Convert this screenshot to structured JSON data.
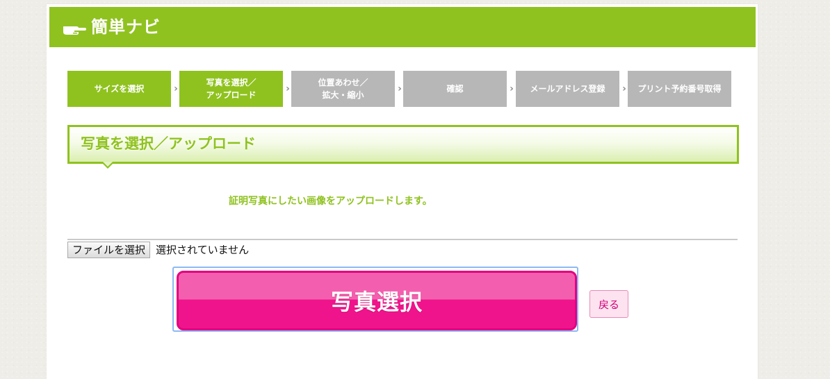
{
  "header": {
    "icon": "pointing-hand-icon",
    "title": "簡単ナビ"
  },
  "steps": [
    {
      "label": "サイズを選択",
      "state": "active"
    },
    {
      "label": "写真を選択／\nアップロード",
      "state": "active"
    },
    {
      "label": "位置あわせ／\n拡大・縮小",
      "state": "inactive"
    },
    {
      "label": "確認",
      "state": "inactive"
    },
    {
      "label": "メールアドレス登録",
      "state": "inactive"
    },
    {
      "label": "プリント予約番号取得",
      "state": "inactive"
    }
  ],
  "section": {
    "title": "写真を選択／アップロード"
  },
  "instruction": "証明写真にしたい画像をアップロードします。",
  "file_input": {
    "button_label": "ファイルを選択",
    "status": "選択されていません"
  },
  "actions": {
    "submit_label": "写真選択",
    "back_label": "戻る"
  },
  "colors": {
    "brand_green": "#8fc21f",
    "inactive_gray": "#b7b7b7",
    "accent_pink": "#f0148c"
  }
}
